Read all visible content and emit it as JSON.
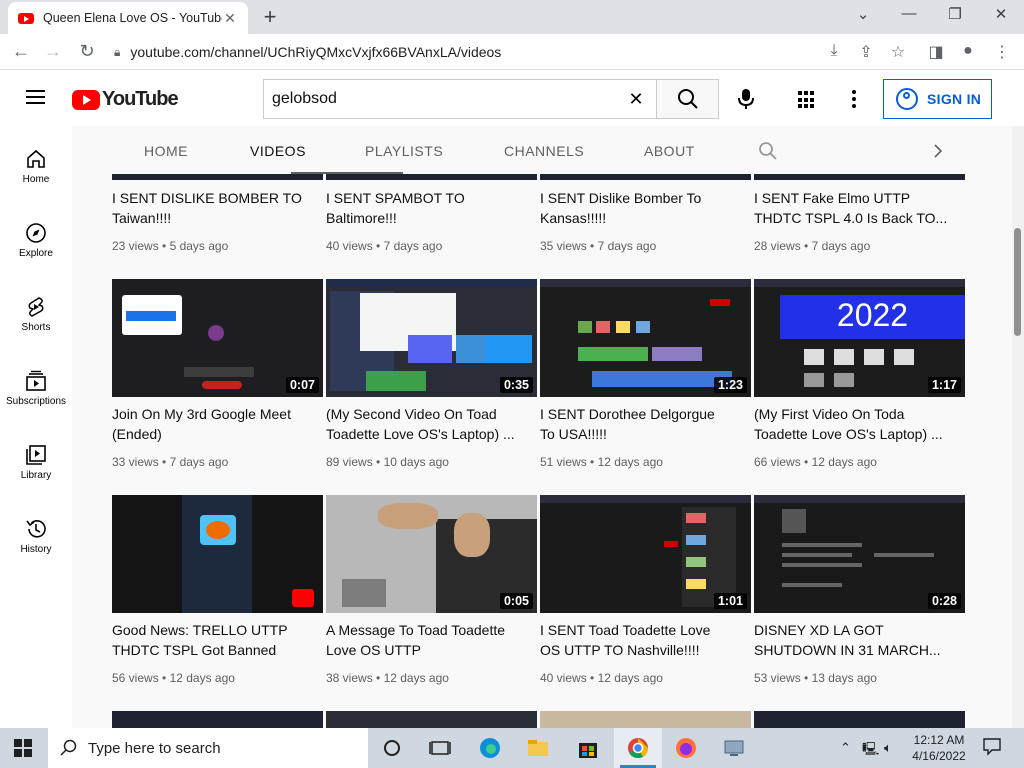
{
  "browser": {
    "tab_title": "Queen Elena Love OS - YouTube",
    "url": "youtube.com/channel/UChRiyQMxcVxjfx66BVAnxLA/videos"
  },
  "header": {
    "logo_text": "YouTube",
    "search_value": "gelobsod",
    "sign_in_label": "SIGN IN"
  },
  "rail": [
    {
      "label": "Home",
      "icon": "home-icon"
    },
    {
      "label": "Explore",
      "icon": "compass-icon"
    },
    {
      "label": "Shorts",
      "icon": "shorts-icon"
    },
    {
      "label": "Subscriptions",
      "icon": "subscriptions-icon"
    },
    {
      "label": "Library",
      "icon": "library-icon"
    },
    {
      "label": "History",
      "icon": "history-icon"
    }
  ],
  "channel_tabs": [
    "HOME",
    "VIDEOS",
    "PLAYLISTS",
    "CHANNELS",
    "ABOUT"
  ],
  "videos_row0": [
    {
      "title_l1": "I SENT DISLIKE BOMBER TO",
      "title_l2": "Taiwan!!!!",
      "views": "23 views",
      "age": "5 days ago"
    },
    {
      "title_l1": "I SENT SPAMBOT TO",
      "title_l2": "Baltimore!!!",
      "views": "40 views",
      "age": "7 days ago"
    },
    {
      "title_l1": "I SENT Dislike Bomber To",
      "title_l2": "Kansas!!!!!",
      "views": "35 views",
      "age": "7 days ago"
    },
    {
      "title_l1": "I SENT Fake Elmo UTTP",
      "title_l2": "THDTC TSPL 4.0 Is Back TO...",
      "views": "28 views",
      "age": "7 days ago"
    }
  ],
  "videos_row1": [
    {
      "title_l1": "Join On My 3rd Google Meet",
      "title_l2": "(Ended)",
      "views": "33 views",
      "age": "7 days ago",
      "duration": "0:07"
    },
    {
      "title_l1": "(My Second Video On Toad",
      "title_l2": "Toadette Love OS's Laptop) ...",
      "views": "89 views",
      "age": "10 days ago",
      "duration": "0:35"
    },
    {
      "title_l1": "I SENT Dorothee Delgorgue",
      "title_l2": "To USA!!!!!",
      "views": "51 views",
      "age": "12 days ago",
      "duration": "1:23"
    },
    {
      "title_l1": "(My First Video On Toda",
      "title_l2": "Toadette Love OS's Laptop) ...",
      "views": "66 views",
      "age": "12 days ago",
      "duration": "1:17",
      "thumb_text": "2022"
    }
  ],
  "videos_row2": [
    {
      "title_l1": "Good News: TRELLO UTTP",
      "title_l2": "THDTC TSPL Got Banned",
      "views": "56 views",
      "age": "12 days ago",
      "duration": ""
    },
    {
      "title_l1": "A Message To Toad Toadette",
      "title_l2": "Love OS UTTP",
      "views": "38 views",
      "age": "12 days ago",
      "duration": "0:05"
    },
    {
      "title_l1": "I SENT Toad Toadette Love",
      "title_l2": "OS UTTP TO Nashville!!!!",
      "views": "40 views",
      "age": "12 days ago",
      "duration": "1:01"
    },
    {
      "title_l1": "DISNEY XD LA GOT",
      "title_l2": "SHUTDOWN IN 31 MARCH...",
      "views": "53 views",
      "age": "13 days ago",
      "duration": "0:28"
    }
  ],
  "taskbar": {
    "search_placeholder": "Type here to search",
    "time": "12:12 AM",
    "date": "4/16/2022"
  },
  "colors": {
    "yt_red": "#ff0000",
    "link_blue": "#065fd4",
    "thumb_dark": "#202020",
    "blue_banner": "#2230e8"
  }
}
